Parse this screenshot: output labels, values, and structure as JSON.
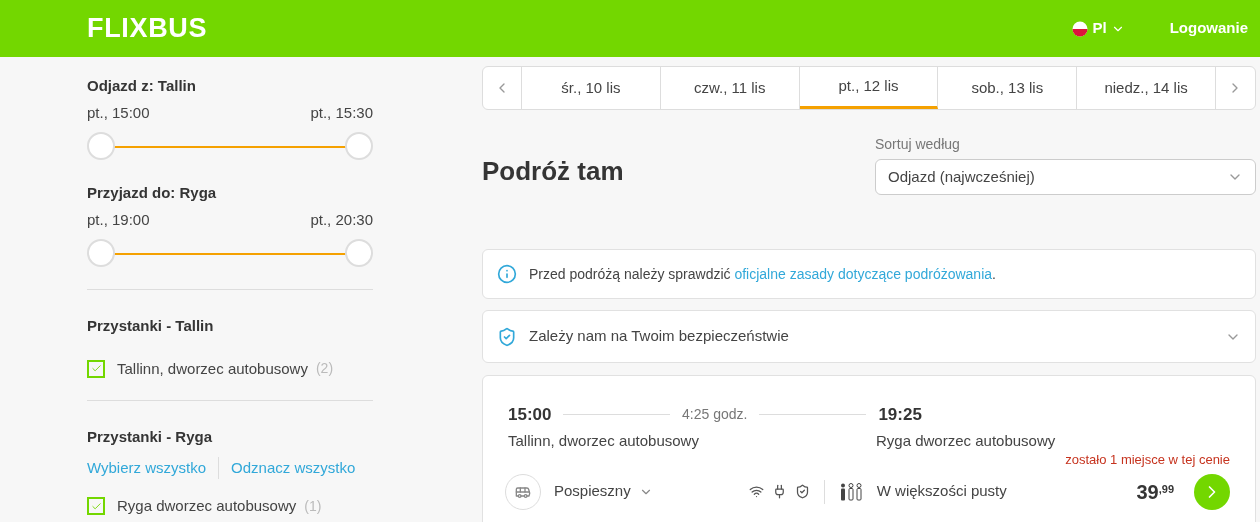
{
  "header": {
    "logo": "FLIXBUS",
    "language": "Pl",
    "login": "Logowanie"
  },
  "filters": {
    "sliders": [
      {
        "title": "Odjazd z: Tallin",
        "from": "pt., 15:00",
        "to": "pt., 15:30",
        "thumbs": [
          {
            "level": 0
          },
          {
            "level": 1
          }
        ]
      },
      {
        "title": "Przyjazd do: Ryga",
        "from": "pt., 19:00",
        "to": "pt., 20:30",
        "thumbs": [
          {
            "level": 0
          },
          {
            "level": 1
          }
        ]
      }
    ],
    "stop_groups": [
      {
        "title": "Przystanki - Tallin",
        "stops": [
          {
            "label": "Tallinn, dworzec autobusowy",
            "count": "(2)",
            "checked": true
          }
        ]
      },
      {
        "title": "Przystanki - Ryga",
        "links": [
          "Wybierz wszystko",
          "Odznacz wszystko"
        ],
        "stops": [
          {
            "label": "Ryga dworzec autobusowy",
            "count": "(1)",
            "checked": true
          }
        ]
      }
    ]
  },
  "date_tabs": [
    {
      "label": "śr., 10 lis",
      "selected": false
    },
    {
      "label": "czw., 11 lis",
      "selected": false
    },
    {
      "label": "pt., 12 lis",
      "selected": true
    },
    {
      "label": "sob., 13 lis",
      "selected": false
    },
    {
      "label": "niedz., 14 lis",
      "selected": false
    }
  ],
  "heading": "Podróż tam",
  "sort": {
    "label": "Sortuj według",
    "value": "Odjazd (najwcześniej)"
  },
  "notice": {
    "text": "Przed podróżą należy sprawdzić ",
    "link": "oficjalne zasady dotyczące podróżowania",
    "end": "."
  },
  "safety": {
    "text": "Zależy nam na Twoim bezpieczeństwie"
  },
  "trip": {
    "departure": "15:00",
    "duration": "4:25 godz.",
    "arrival": "19:25",
    "from": "Tallinn, dworzec autobusowy",
    "to": "Ryga dworzec autobusowy",
    "seats_warning": "zostało 1 miejsce w tej cenie",
    "type": "Pospieszny",
    "occupancy": "W większości pusty",
    "price": "39$^{,99}$"
  }
}
